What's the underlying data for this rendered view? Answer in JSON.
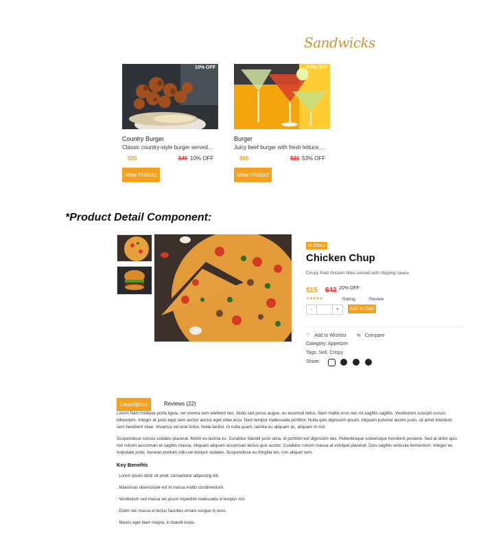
{
  "sandwiches_title": "Sandwicks",
  "cards": [
    {
      "badge": "10% OFF",
      "name": "Country Burger",
      "desc": "Classic country-style burger served...",
      "price": "$50",
      "old_price": "$45",
      "off": "10% OFF",
      "button": "View Product"
    },
    {
      "badge": "53% OFF",
      "name": "Burger",
      "desc": "Juicy beef burger with fresh lettuce,...",
      "price": "$46",
      "old_price": "$21",
      "off": "53% OFF",
      "button": "View Product"
    }
  ],
  "section_heading": "*Product Detail Component:",
  "product": {
    "stock": "In Stock",
    "title": "Chicken Chup",
    "description": "Crispy fried chicken bites served with clipping sauce.",
    "price": "$15",
    "old_price": "$42",
    "off": "20% OFF",
    "stars": "★★★★★",
    "rating_label": "Rating",
    "review_label": "Review",
    "qty_minus": "-",
    "qty_value": "",
    "qty_plus": "+",
    "add_to_cart": "Add to Cart",
    "wishlist": "Add to Wishlist",
    "compare": "Compare",
    "category": "Category: Appetizer",
    "tags": "Tags: Sell, Crispy",
    "share": "Share:"
  },
  "tabs": {
    "description": "Description",
    "reviews": "Reviews (22)"
  },
  "paragraphs": [
    "Lorem Nam tristique porta ligula, vel viverra sem eleifend nec. Nulla sed purus augue, eu euismod tellus. Nam mattis eros nec mi sagittis sagittis. Vestibulum suscipit cursus bibendum. Integer at justo eget sem auctor auctor eget vitae arcu. Nam tempor malesuada porttitor. Nulla quis dignissim ipsum. Aliquam pulvinar iaculis justo, sit amet interdum sem hendrerit vitae. Vivamus vel erat tortor. Nulla facilisi. In nulla quam, lacinia eu aliquam ac, aliquam in nisl.",
    "Suspendisse cursus sodales placerat. Morbi eu lacinia ex. Curabitur blandit justo urna, id porttitor est dignissim nec. Pellentesque scelerisque hendrerit posuere. Sed at dolor quis nisi rutrum accumsan et sagittis massa. Aliquam aliquam accumsan lectus quis auctor. Curabitur rutrum massa at volutpat placerat. Duis sagittis vehicula fermentum. Integer eu vulputate justo. Aenean pretium odio vel tempor sodales. Suspendisse eu fringilla leo, non aliquet sem."
  ],
  "key_benefits": "Key Benefits",
  "benefits": [
    ". Lorem ipsum dolor sit amet, consectetur adipiscing elit.",
    ". Maecenas ullamcorper est et massa mattis condimentum.",
    ". Vestibulum sed massa vel ipsum imperdiet malesuada id tempus nisl.",
    ". Etiam nec massa et lectus faucibus ornare congue in nunc.",
    ". Mauris eget diam magna, in blandit turpis."
  ],
  "colors": {
    "accent": "#f5a01e",
    "price": "#f0a020",
    "old_price": "#e03b3b",
    "script_title": "#c9952e"
  }
}
